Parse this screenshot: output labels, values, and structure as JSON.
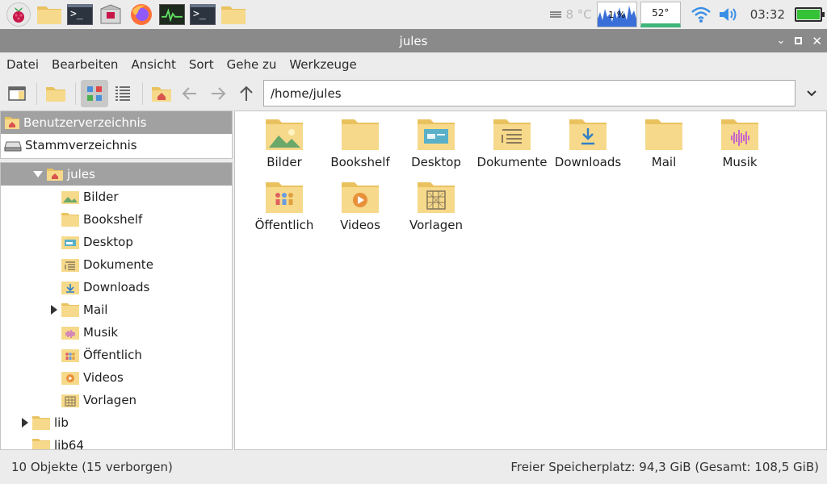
{
  "taskbar": {
    "temperature_text": "8 °C",
    "cpu_label": "1 %",
    "cpu_temp": "52°",
    "clock": "03:32",
    "icons": [
      "raspberry-menu-icon",
      "folder-icon",
      "terminal-icon",
      "package-icon",
      "firefox-icon",
      "cpu-monitor-icon",
      "terminal-icon",
      "folder-icon"
    ],
    "terminal_prompt": ">_"
  },
  "window": {
    "title": "jules"
  },
  "menu": {
    "items": [
      "Datei",
      "Bearbeiten",
      "Ansicht",
      "Sort",
      "Gehe zu",
      "Werkzeuge"
    ]
  },
  "toolbar": {
    "path": "/home/jules"
  },
  "sidebar": {
    "places": [
      {
        "label": "Benutzerverzeichnis",
        "icon": "home-folder-icon"
      },
      {
        "label": "Stammverzeichnis",
        "icon": "drive-icon"
      }
    ],
    "tree": [
      {
        "label": "jules",
        "icon": "home-folder-icon",
        "level": 1,
        "expanded": true
      },
      {
        "label": "Bilder",
        "icon": "pictures-folder-icon",
        "level": 2
      },
      {
        "label": "Bookshelf",
        "icon": "folder-icon",
        "level": 2
      },
      {
        "label": "Desktop",
        "icon": "desktop-folder-icon",
        "level": 2
      },
      {
        "label": "Dokumente",
        "icon": "documents-folder-icon",
        "level": 2
      },
      {
        "label": "Downloads",
        "icon": "downloads-folder-icon",
        "level": 2
      },
      {
        "label": "Mail",
        "icon": "folder-icon",
        "level": 2,
        "collapsed": true
      },
      {
        "label": "Musik",
        "icon": "music-folder-icon",
        "level": 2
      },
      {
        "label": "Öffentlich",
        "icon": "public-folder-icon",
        "level": 2
      },
      {
        "label": "Videos",
        "icon": "videos-folder-icon",
        "level": 2
      },
      {
        "label": "Vorlagen",
        "icon": "templates-folder-icon",
        "level": 2
      },
      {
        "label": "lib",
        "icon": "folder-icon",
        "level": 0,
        "collapsed": true
      },
      {
        "label": "lib64",
        "icon": "folder-icon",
        "level": 0
      }
    ]
  },
  "files": [
    {
      "label": "Bilder",
      "icon": "pictures-folder-icon"
    },
    {
      "label": "Bookshelf",
      "icon": "folder-icon"
    },
    {
      "label": "Desktop",
      "icon": "desktop-folder-icon"
    },
    {
      "label": "Dokumente",
      "icon": "documents-folder-icon"
    },
    {
      "label": "Downloads",
      "icon": "downloads-folder-icon"
    },
    {
      "label": "Mail",
      "icon": "folder-icon"
    },
    {
      "label": "Musik",
      "icon": "music-folder-icon"
    },
    {
      "label": "Öffentlich",
      "icon": "public-folder-icon"
    },
    {
      "label": "Videos",
      "icon": "videos-folder-icon"
    },
    {
      "label": "Vorlagen",
      "icon": "templates-folder-icon"
    }
  ],
  "status": {
    "left": "10 Objekte (15 verborgen)",
    "right": "Freier Speicherplatz: 94,3 GiB (Gesamt: 108,5 GiB)"
  },
  "colors": {
    "folder": "#f6d98a",
    "folder_dark": "#e9c25f",
    "selection": "#a1a1a1",
    "titlebar": "#8a8a8a"
  }
}
